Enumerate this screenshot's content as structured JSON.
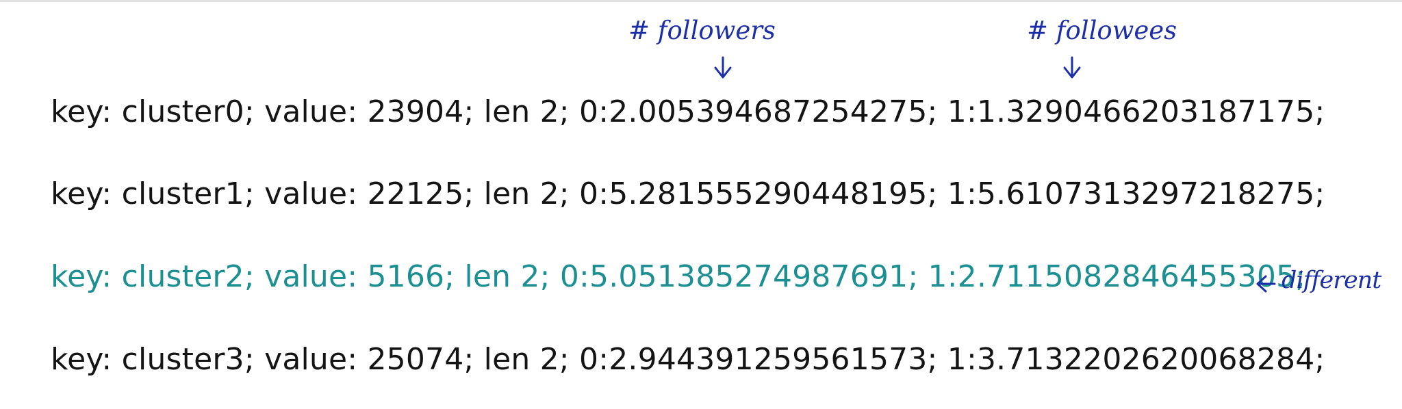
{
  "lines": [
    {
      "text": "key: cluster0; value: 23904; len 2; 0:2.005394687254275; 1:1.3290466203187175;"
    },
    {
      "text": "key: cluster1; value: 22125; len 2; 0:5.281555290448195; 1:5.6107313297218275;"
    },
    {
      "text": "key: cluster2; value: 5166; len 2; 0:5.051385274987691; 1:2.7115082846455305;"
    },
    {
      "text": "key: cluster3; value: 25074; len 2; 0:2.944391259561573; 1:3.7132202620068284;"
    }
  ],
  "annotations": {
    "followers": "# followers",
    "followees": "# followees",
    "different": "different"
  },
  "colors": {
    "text": "#141414",
    "highlight": "#1b8f91",
    "ink": "#1c2fa6"
  }
}
